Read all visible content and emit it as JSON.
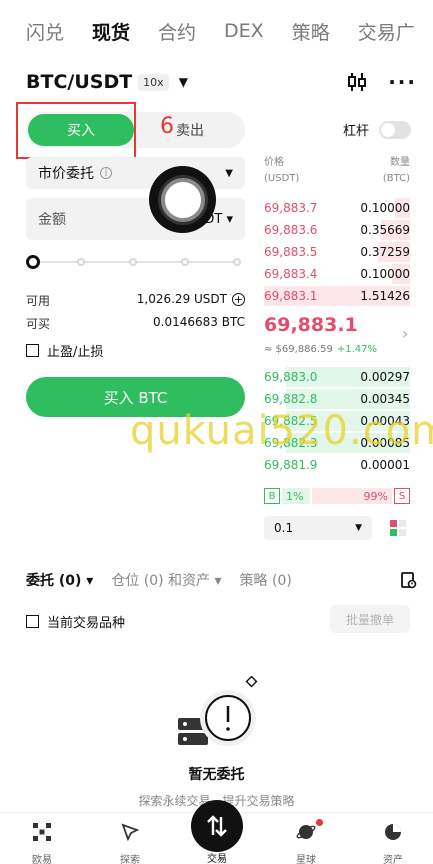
{
  "top_tabs": [
    "闪兑",
    "现货",
    "合约",
    "DEX",
    "策略",
    "交易广"
  ],
  "top_tab_active": 1,
  "pair": {
    "name": "BTC/USDT",
    "leverage": "10x"
  },
  "leverage_toggle_label": "杠杆",
  "trade_side": {
    "buy": "买入",
    "sell": "卖出",
    "step_number": "6"
  },
  "order_type": "市价委托",
  "amount": {
    "placeholder": "金额",
    "unit": "USDT"
  },
  "balances": {
    "available_label": "可用",
    "available_value": "1,026.29 USDT",
    "can_buy_label": "可买",
    "can_buy_value": "0.0146683 BTC"
  },
  "tp_sl_label": "止盈/止损",
  "buy_button": "买入 BTC",
  "orderbook": {
    "price_header": "价格",
    "price_unit": "(USDT)",
    "qty_header": "数量",
    "qty_unit": "(BTC)",
    "asks": [
      {
        "price": "69,883.7",
        "qty": "0.10000",
        "depth": 0.1
      },
      {
        "price": "69,883.6",
        "qty": "0.35669",
        "depth": 0.2
      },
      {
        "price": "69,883.5",
        "qty": "0.37259",
        "depth": 0.22
      },
      {
        "price": "69,883.4",
        "qty": "0.10000",
        "depth": 0.12
      },
      {
        "price": "69,883.1",
        "qty": "1.51426",
        "depth": 1.0
      }
    ],
    "last_price": "69,883.1",
    "last_price_usd": "≈ $69,886.59",
    "change": "+1.47%",
    "bids": [
      {
        "price": "69,883.0",
        "qty": "0.00297",
        "depth": 0.85
      },
      {
        "price": "69,882.8",
        "qty": "0.00345",
        "depth": 0.85
      },
      {
        "price": "69,882.5",
        "qty": "0.00043",
        "depth": 0.85
      },
      {
        "price": "69,882.3",
        "qty": "0.00085",
        "depth": 0.85
      },
      {
        "price": "69,881.9",
        "qty": "0.00001",
        "depth": 0.0
      }
    ],
    "buy_ratio_label": "B",
    "buy_ratio": "1%",
    "sell_ratio": "99%",
    "sell_ratio_label": "S",
    "precision": "0.1"
  },
  "order_tabs": [
    "委托 (0)",
    "仓位 (0) 和资产",
    "策略 (0)"
  ],
  "current_pair_only": "当前交易品种",
  "batch_cancel": "批量撤单",
  "empty_title": "暂无委托",
  "empty_sub": "探索永续交易，提升交易策略",
  "watermark": "qukuai520.com",
  "bottom_nav": [
    "欧易",
    "探索",
    "交易",
    "星球",
    "资产"
  ],
  "colors": {
    "green": "#2ebd5f",
    "red": "#e24d6b",
    "highlight": "#e53935"
  }
}
